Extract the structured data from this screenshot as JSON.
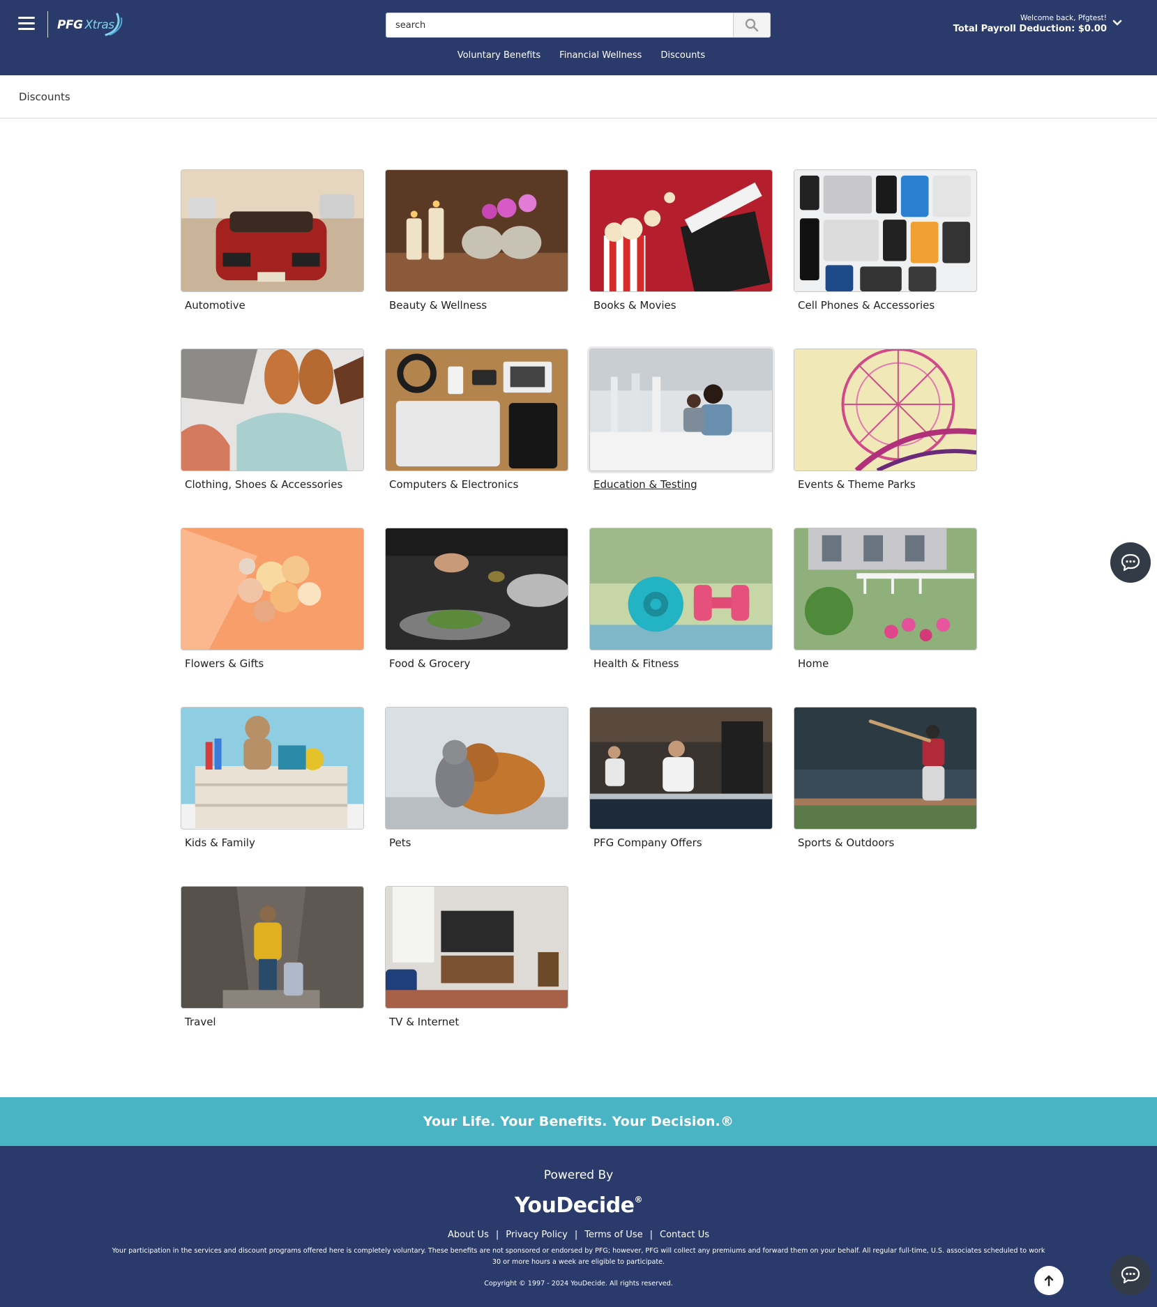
{
  "header": {
    "logo_text_main": "PFG",
    "logo_text_accent": "Xtras",
    "search_placeholder": "search",
    "nav": [
      "Voluntary Benefits",
      "Financial Wellness",
      "Discounts"
    ],
    "welcome": "Welcome back, Pfgtest!",
    "payroll": "Total Payroll Deduction: $0.00"
  },
  "breadcrumb": "Discounts",
  "categories": [
    {
      "label": "Automotive",
      "image": "red-convertible-car"
    },
    {
      "label": "Beauty & Wellness",
      "image": "spa-candles-towels-orchid"
    },
    {
      "label": "Books & Movies",
      "image": "popcorn-clapperboard"
    },
    {
      "label": "Cell Phones & Accessories",
      "image": "phones-tablets-grid"
    },
    {
      "label": "Clothing, Shoes & Accessories",
      "image": "shoes-sweaters"
    },
    {
      "label": "Computers & Electronics",
      "image": "laptop-headphones-tablet"
    },
    {
      "label": "Education & Testing",
      "image": "students-computer-lab"
    },
    {
      "label": "Events & Theme Parks",
      "image": "ferris-wheel"
    },
    {
      "label": "Flowers & Gifts",
      "image": "rose-bouquet"
    },
    {
      "label": "Food & Grocery",
      "image": "chef-plating-salad"
    },
    {
      "label": "Health & Fitness",
      "image": "yoga-mat-dumbbell"
    },
    {
      "label": "Home",
      "image": "house-garden-flowers"
    },
    {
      "label": "Kids & Family",
      "image": "toy-crate-teddy-bear"
    },
    {
      "label": "Pets",
      "image": "cat-and-dog"
    },
    {
      "label": "PFG Company Offers",
      "image": "restaurant-kitchen-chef"
    },
    {
      "label": "Sports & Outdoors",
      "image": "baseball-batter"
    },
    {
      "label": "Travel",
      "image": "traveler-with-suitcase"
    },
    {
      "label": "TV & Internet",
      "image": "living-room-tv"
    }
  ],
  "active_category_index": 6,
  "footer": {
    "tagline": "Your Life. Your Benefits. Your Decision.®",
    "powered_by": "Powered By",
    "brand": "YouDecide",
    "brand_mark": "®",
    "links": [
      "About Us",
      "Privacy Policy",
      "Terms of Use",
      "Contact Us"
    ],
    "link_separator": "|",
    "disclaimer": "Your participation in the services and discount programs offered here is completely voluntary. These benefits are not sponsored or endorsed by PFG; however, PFG will collect any premiums and forward them on your behalf. All regular full-time, U.S. associates scheduled to work 30 or more hours a week are eligible to participate.",
    "copyright": "Copyright © 1997 - 2024 YouDecide. All rights reserved."
  },
  "colors": {
    "header_bg": "#2a3a6b",
    "tagline_bg": "#48b4c4",
    "chat_bg": "#333b47"
  }
}
